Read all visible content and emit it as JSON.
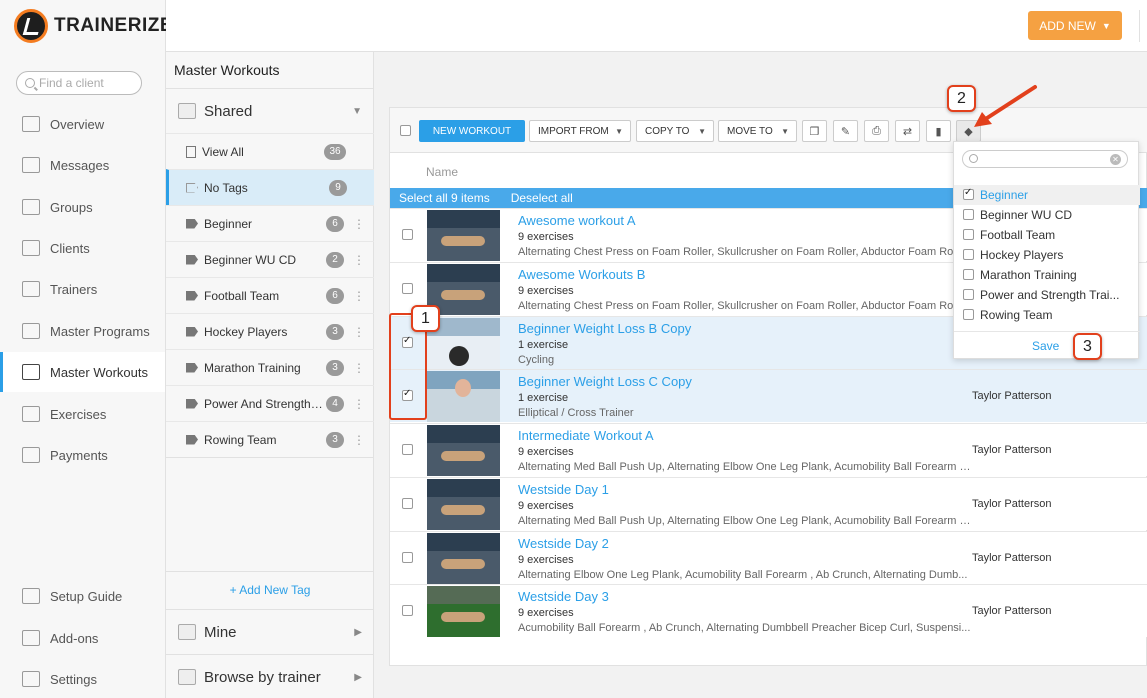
{
  "app": {
    "logo_text": "TRAINERIZE"
  },
  "search": {
    "placeholder": "Find a client"
  },
  "nav": [
    {
      "label": "Overview",
      "icon": "overview-icon"
    },
    {
      "label": "Messages",
      "icon": "messages-icon"
    },
    {
      "label": "Groups",
      "icon": "groups-icon"
    },
    {
      "label": "Clients",
      "icon": "clients-icon"
    },
    {
      "label": "Trainers",
      "icon": "trainers-icon"
    },
    {
      "label": "Master Programs",
      "icon": "programs-icon"
    },
    {
      "label": "Master Workouts",
      "icon": "workouts-icon",
      "active": true
    },
    {
      "label": "Exercises",
      "icon": "exercises-icon"
    },
    {
      "label": "Payments",
      "icon": "payments-icon"
    }
  ],
  "nav_bottom": [
    {
      "label": "Setup Guide",
      "icon": "setup-icon"
    },
    {
      "label": "Add-ons",
      "icon": "addons-icon"
    },
    {
      "label": "Settings",
      "icon": "gear-icon"
    }
  ],
  "header": {
    "add_new_label": "ADD NEW",
    "add_new_caret": "▼"
  },
  "tags_panel": {
    "title": "Master Workouts",
    "shared_label": "Shared",
    "shared_caret": "▼",
    "view_all": {
      "label": "View All",
      "count": "36"
    },
    "no_tags": {
      "label": "No Tags",
      "count": "9"
    },
    "tags": [
      {
        "label": "Beginner",
        "count": "6"
      },
      {
        "label": "Beginner WU CD",
        "count": "2"
      },
      {
        "label": "Football Team",
        "count": "6"
      },
      {
        "label": "Hockey Players",
        "count": "3"
      },
      {
        "label": "Marathon Training",
        "count": "3"
      },
      {
        "label": "Power And Strength T...",
        "count": "4"
      },
      {
        "label": "Rowing Team",
        "count": "3"
      }
    ],
    "add_tag_label": "+ Add New Tag",
    "mine_label": "Mine",
    "browse_label": "Browse by trainer",
    "expand_caret": "▶"
  },
  "toolbar": {
    "new_workout": "NEW WORKOUT",
    "import_from": "IMPORT FROM",
    "copy_to": "COPY TO",
    "move_to": "MOVE TO",
    "caret": "▼"
  },
  "list": {
    "column_name": "Name",
    "select_all": "Select all 9 items",
    "deselect_all": "Deselect all",
    "rows": [
      {
        "title": "Awesome workout A",
        "count": "9 exercises",
        "desc": "Alternating Chest Press on Foam Roller, Skullcrusher on Foam Roller, Abductor Foam Roll, Foam Roll Side Lying Quad...",
        "owner": "",
        "checked": false,
        "thumb": "gym"
      },
      {
        "title": "Awesome Workouts B",
        "count": "9 exercises",
        "desc": "Alternating Chest Press on Foam Roller, Skullcrusher on Foam Roller, Abductor Foam Roll, Foam Roll Side Lying Quad...",
        "owner": "",
        "checked": false,
        "thumb": "gym"
      },
      {
        "title": "Beginner Weight Loss B Copy",
        "count": "1 exercise",
        "desc": "Cycling",
        "owner": "",
        "checked": true,
        "thumb": "bike"
      },
      {
        "title": "Beginner Weight Loss C Copy",
        "count": "1 exercise",
        "desc": "Elliptical / Cross Trainer",
        "owner": "Taylor Patterson",
        "checked": true,
        "thumb": "ellip"
      },
      {
        "title": "Intermediate Workout A",
        "count": "9 exercises",
        "desc": "Alternating Med Ball Push Up, Alternating Elbow One Leg Plank, Acumobility Ball Forearm , ...",
        "owner": "Taylor Patterson",
        "checked": false,
        "thumb": "gym"
      },
      {
        "title": "Westside Day 1",
        "count": "9 exercises",
        "desc": "Alternating Med Ball Push Up, Alternating Elbow One Leg Plank, Acumobility Ball Forearm , ...",
        "owner": "Taylor Patterson",
        "checked": false,
        "thumb": "gym"
      },
      {
        "title": "Westside Day 2",
        "count": "9 exercises",
        "desc": "Alternating Elbow One Leg Plank, Acumobility Ball Forearm , Ab Crunch, Alternating Dumb...",
        "owner": "Taylor Patterson",
        "checked": false,
        "thumb": "gym"
      },
      {
        "title": "Westside Day 3",
        "count": "9 exercises",
        "desc": "Acumobility Ball Forearm , Ab Crunch, Alternating Dumbbell Preacher Bicep Curl, Suspensi...",
        "owner": "Taylor Patterson",
        "checked": false,
        "thumb": "green"
      }
    ]
  },
  "tag_dropdown": {
    "options": [
      {
        "label": "Beginner",
        "checked": true
      },
      {
        "label": "Beginner WU CD",
        "checked": false
      },
      {
        "label": "Football Team",
        "checked": false
      },
      {
        "label": "Hockey Players",
        "checked": false
      },
      {
        "label": "Marathon Training",
        "checked": false
      },
      {
        "label": "Power and Strength Trai...",
        "checked": false
      },
      {
        "label": "Rowing Team",
        "checked": false
      }
    ],
    "save_label": "Save"
  },
  "annotations": {
    "n1": "1",
    "n2": "2",
    "n3": "3"
  },
  "colors": {
    "accent": "#2b9fe7",
    "add_new": "#f5a142",
    "annotation": "#e2401c"
  }
}
